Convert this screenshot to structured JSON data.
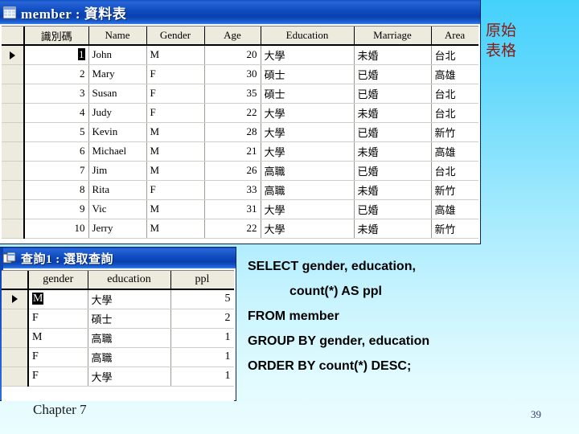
{
  "slide": {
    "background_top_color": "#45D1FC",
    "background_bottom_color": "#EAFDFF",
    "footer_chapter": "Chapter 7",
    "page_number": "39",
    "annotation_label": "原始\n表格",
    "annotation_color": "#8B1A12"
  },
  "member_window": {
    "title": "member : 資料表",
    "title_icon": "table-icon",
    "record_indicator": "current-record-arrow",
    "columns": [
      "識別碼",
      "Name",
      "Gender",
      "Age",
      "Education",
      "Marriage",
      "Area"
    ],
    "selected_cell": {
      "row": 0,
      "column": "識別碼",
      "value": "1"
    },
    "rows": [
      {
        "id": "1",
        "name": "John",
        "gender": "M",
        "age": "20",
        "education": "大學",
        "marriage": "未婚",
        "area": "台北"
      },
      {
        "id": "2",
        "name": "Mary",
        "gender": "F",
        "age": "30",
        "education": "碩士",
        "marriage": "已婚",
        "area": "高雄"
      },
      {
        "id": "3",
        "name": "Susan",
        "gender": "F",
        "age": "35",
        "education": "碩士",
        "marriage": "已婚",
        "area": "台北"
      },
      {
        "id": "4",
        "name": "Judy",
        "gender": "F",
        "age": "22",
        "education": "大學",
        "marriage": "未婚",
        "area": "台北"
      },
      {
        "id": "5",
        "name": "Kevin",
        "gender": "M",
        "age": "28",
        "education": "大學",
        "marriage": "已婚",
        "area": "新竹"
      },
      {
        "id": "6",
        "name": "Michael",
        "gender": "M",
        "age": "21",
        "education": "大學",
        "marriage": "未婚",
        "area": "高雄"
      },
      {
        "id": "7",
        "name": "Jim",
        "gender": "M",
        "age": "26",
        "education": "高職",
        "marriage": "已婚",
        "area": "台北"
      },
      {
        "id": "8",
        "name": "Rita",
        "gender": "F",
        "age": "33",
        "education": "高職",
        "marriage": "未婚",
        "area": "新竹"
      },
      {
        "id": "9",
        "name": "Vic",
        "gender": "M",
        "age": "31",
        "education": "大學",
        "marriage": "已婚",
        "area": "高雄"
      },
      {
        "id": "10",
        "name": "Jerry",
        "gender": "M",
        "age": "22",
        "education": "大學",
        "marriage": "未婚",
        "area": "新竹"
      }
    ]
  },
  "query_window": {
    "title": "查詢1 : 選取查詢",
    "title_icon": "query-icon",
    "record_indicator": "current-record-arrow",
    "columns": [
      "gender",
      "education",
      "ppl"
    ],
    "selected_cell": {
      "row": 0,
      "column": "gender",
      "value": "M"
    },
    "rows": [
      {
        "gender": "M",
        "education": "大學",
        "ppl": "5"
      },
      {
        "gender": "F",
        "education": "碩士",
        "ppl": "2"
      },
      {
        "gender": "M",
        "education": "高職",
        "ppl": "1"
      },
      {
        "gender": "F",
        "education": "高職",
        "ppl": "1"
      },
      {
        "gender": "F",
        "education": "大學",
        "ppl": "1"
      }
    ]
  },
  "sql": {
    "line1": "SELECT gender, education,",
    "line2": "count(*) AS ppl",
    "line3": "FROM member",
    "line4": "GROUP BY gender, education",
    "line5": "ORDER BY count(*) DESC;"
  }
}
